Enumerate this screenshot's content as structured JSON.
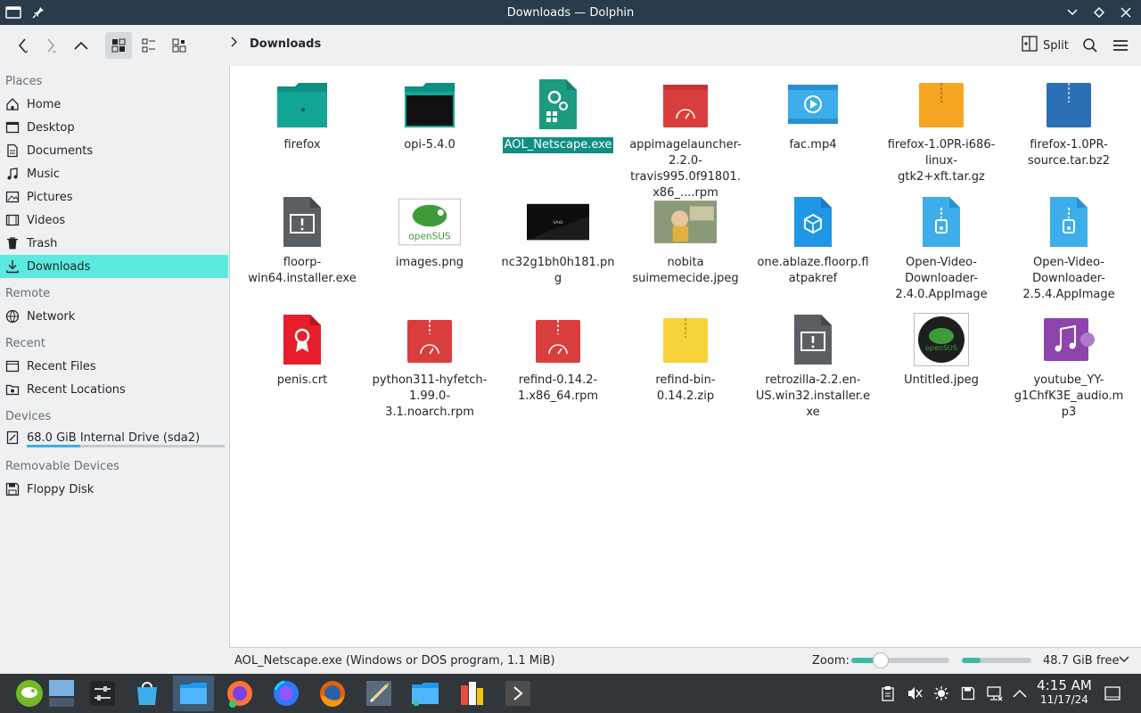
{
  "window": {
    "title": "Downloads — Dolphin"
  },
  "toolbar": {
    "breadcrumb": "Downloads",
    "split_label": "Split"
  },
  "sidebar": {
    "places_title": "Places",
    "places": [
      "Home",
      "Desktop",
      "Documents",
      "Music",
      "Pictures",
      "Videos",
      "Trash",
      "Downloads"
    ],
    "remote_title": "Remote",
    "remote": [
      "Network"
    ],
    "recent_title": "Recent",
    "recent": [
      "Recent Files",
      "Recent Locations"
    ],
    "devices_title": "Devices",
    "devices": [
      "68.0 GiB Internal Drive (sda2)"
    ],
    "drive_used_fraction": 0.27,
    "removable_title": "Removable Devices",
    "removable": [
      "Floppy Disk"
    ]
  },
  "files": [
    {
      "name": "firefox"
    },
    {
      "name": "opi-5.4.0"
    },
    {
      "name": "AOL_Netscape.exe"
    },
    {
      "name": "appimagelauncher-2.2.0-travis995.0f91801.x86_....rpm"
    },
    {
      "name": "fac.mp4"
    },
    {
      "name": "firefox-1.0PR-i686-linux-gtk2+xft.tar.gz"
    },
    {
      "name": "firefox-1.0PR-source.tar.bz2"
    },
    {
      "name": "floorp-win64.installer.exe"
    },
    {
      "name": "images.png",
      "thumb_text": "openSUS"
    },
    {
      "name": "nc32g1bh0h181.png",
      "thumb_text": "VAIO"
    },
    {
      "name": "nobita suimemecide.jpeg"
    },
    {
      "name": "one.ablaze.floorp.flatpakref"
    },
    {
      "name": "Open-Video-Downloader-2.4.0.AppImage"
    },
    {
      "name": "Open-Video-Downloader-2.5.4.AppImage"
    },
    {
      "name": "penis.crt"
    },
    {
      "name": "python311-hyfetch-1.99.0-3.1.noarch.rpm"
    },
    {
      "name": "refind-0.14.2-1.x86_64.rpm"
    },
    {
      "name": "refind-bin-0.14.2.zip"
    },
    {
      "name": "retrozilla-2.2.en-US.win32.installer.exe"
    },
    {
      "name": "Untitled.jpeg",
      "thumb_text": "openSUS"
    },
    {
      "name": "youtube_YY-g1ChfK3E_audio.mp3"
    }
  ],
  "statusbar": {
    "info": "AOL_Netscape.exe (Windows or DOS program, 1.1 MiB)",
    "zoom_label": "Zoom:",
    "zoom_fraction": 0.3,
    "free_space": "48.7 GiB free",
    "used_fraction": 0.27
  },
  "taskbar": {
    "time": "4:15 AM",
    "date": "11/17/24"
  },
  "colors": {
    "accent": "#3daee9",
    "selection": "#0e8f84",
    "place_selected": "#5ce9df",
    "titlebar": "#2a3b4b",
    "taskbar": "#31363b"
  }
}
